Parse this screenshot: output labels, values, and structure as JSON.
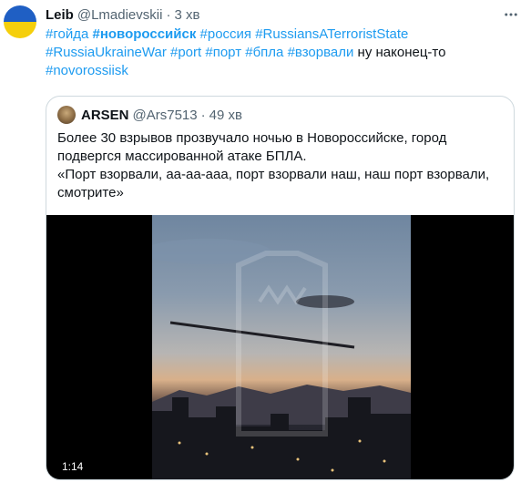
{
  "tweet": {
    "display_name": "Leib",
    "handle": "@Lmadievskii",
    "separator": "·",
    "time": "3 хв",
    "avatar_icon": "ukraine-flag-avatar",
    "text_parts": [
      {
        "text": "#гойда",
        "tag": true,
        "strong": false
      },
      {
        "text": " ",
        "tag": false,
        "strong": false
      },
      {
        "text": "#новороссийск",
        "tag": true,
        "strong": true
      },
      {
        "text": " ",
        "tag": false,
        "strong": false
      },
      {
        "text": "#россия",
        "tag": true,
        "strong": false
      },
      {
        "text": " ",
        "tag": false,
        "strong": false
      },
      {
        "text": "#RussiansATerroristState",
        "tag": true,
        "strong": false
      },
      {
        "text": " ",
        "tag": false,
        "strong": false
      },
      {
        "text": "#RussiaUkraineWar",
        "tag": true,
        "strong": false
      },
      {
        "text": " ",
        "tag": false,
        "strong": false
      },
      {
        "text": "#port",
        "tag": true,
        "strong": false
      },
      {
        "text": " ",
        "tag": false,
        "strong": false
      },
      {
        "text": "#порт",
        "tag": true,
        "strong": false
      },
      {
        "text": " ",
        "tag": false,
        "strong": false
      },
      {
        "text": "#бпла",
        "tag": true,
        "strong": false
      },
      {
        "text": " ",
        "tag": false,
        "strong": false
      },
      {
        "text": "#взорвали",
        "tag": true,
        "strong": false
      },
      {
        "text": " ну наконец-то ",
        "tag": false,
        "strong": false
      },
      {
        "text": "#novorossiisk",
        "tag": true,
        "strong": false
      }
    ]
  },
  "quote": {
    "display_name": "ARSEN",
    "handle": "@Ars7513",
    "separator": "·",
    "time": "49 хв",
    "paragraphs": [
      "Более 30 взрывов прозвучало ночью в Новороссийске, город подвергся массированной атаке БПЛА.",
      "«Порт взорвали, аа-аа-ааа, порт взорвали наш, наш порт взорвали, смотрите»"
    ],
    "video_duration": "1:14"
  },
  "colors": {
    "accent": "#1d9bf0",
    "text": "#0f1419",
    "muted": "#536471",
    "border": "#cfd9de",
    "flag_blue": "#1f5fc4",
    "flag_yellow": "#f5cf0c"
  }
}
